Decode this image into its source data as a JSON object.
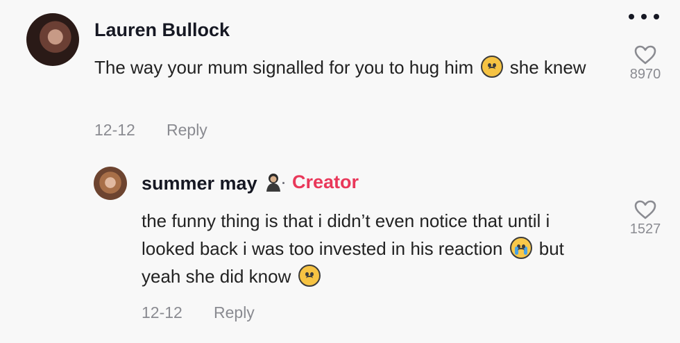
{
  "comment": {
    "username": "Lauren Bullock",
    "text_before_emoji": "The way your mum signalled for you to hug him",
    "text_after_emoji": " she knew",
    "date": "12-12",
    "reply_label": "Reply",
    "like_count": "8970",
    "avatar": "user-avatar"
  },
  "reply": {
    "username": "summer may",
    "separator": "·",
    "creator_label": "Creator",
    "text_line_1": "the funny thing is that i didn’t even notice that until i looked back i was too invested in his reaction",
    "text_line_2": " but yeah she did know",
    "date": "12-12",
    "reply_label": "Reply",
    "like_count": "1527",
    "avatar": "creator-avatar"
  },
  "icons": {
    "more": "more-options-icon",
    "heart": "heart-outline-icon",
    "sad_emoji": "slightly-frowning-face-emoji",
    "crying_emoji": "loudly-crying-face-emoji",
    "person_emoji": "person-emoji"
  },
  "colors": {
    "background": "#f8f8f8",
    "creator_accent": "#e9385a",
    "meta_text": "#8a8b91"
  }
}
